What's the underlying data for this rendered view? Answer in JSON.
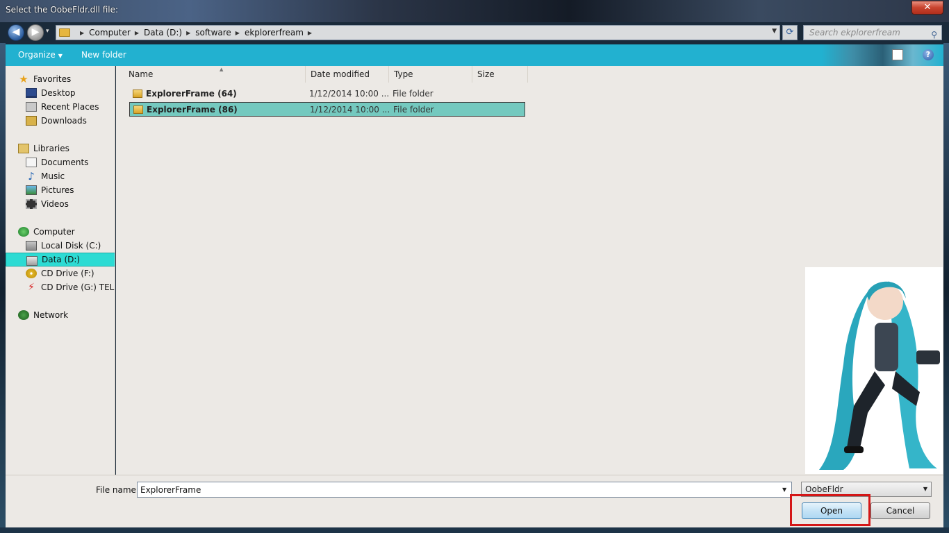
{
  "window": {
    "title": "Select the OobeFldr.dll file:",
    "close_label": "✕"
  },
  "nav": {
    "back_label": "◀",
    "forward_label": "▶",
    "history_label": "▾",
    "breadcrumbs": [
      "Computer",
      "Data (D:)",
      "software",
      "ekplorerfream"
    ],
    "search_placeholder": "Search ekplorerfream"
  },
  "toolbar": {
    "organize": "Organize",
    "new_folder": "New folder",
    "help_label": "?"
  },
  "sidebar": {
    "favorites": {
      "label": "Favorites",
      "items": [
        "Desktop",
        "Recent Places",
        "Downloads"
      ]
    },
    "libraries": {
      "label": "Libraries",
      "items": [
        "Documents",
        "Music",
        "Pictures",
        "Videos"
      ]
    },
    "computer": {
      "label": "Computer",
      "items": [
        "Local Disk (C:)",
        "Data (D:)",
        "CD Drive (F:)",
        "CD Drive (G:) TELI"
      ],
      "selected": "Data (D:)"
    },
    "network": {
      "label": "Network"
    }
  },
  "file_list": {
    "columns": [
      "Name",
      "Date modified",
      "Type",
      "Size"
    ],
    "rows": [
      {
        "name": "ExplorerFrame (64)",
        "date": "1/12/2014 10:00 ...",
        "type": "File folder"
      },
      {
        "name": "ExplorerFrame (86)",
        "date": "1/12/2014 10:00 ...",
        "type": "File folder"
      }
    ],
    "selected_index": 1
  },
  "footer": {
    "file_name_label": "File name:",
    "file_name_value": "ExplorerFrame",
    "filter_value": "OobeFldr",
    "open_label": "Open",
    "cancel_label": "Cancel"
  },
  "colors": {
    "toolbar": "#22b1d0",
    "selection": "#2ddbd3",
    "row_selection": "#74c9bf",
    "highlight_box": "#d41616"
  }
}
